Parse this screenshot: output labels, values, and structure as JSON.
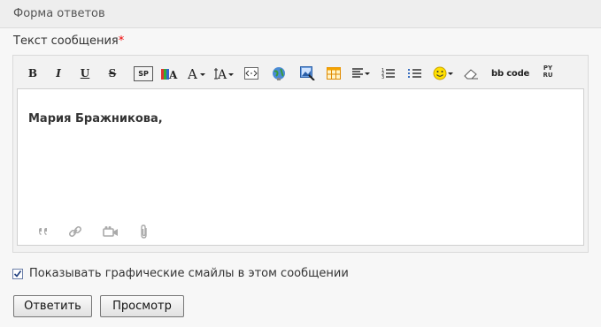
{
  "header": {
    "title": "Форма ответов"
  },
  "form": {
    "label": "Текст сообщения",
    "required_mark": "*"
  },
  "toolbar": {
    "bold": "B",
    "italic": "I",
    "underline": "U",
    "strike": "S",
    "spoiler": "SP",
    "bbcode": "bb code",
    "translit_top": "PY",
    "translit_bottom": "RU"
  },
  "editor": {
    "content": "Мария Бражникова,"
  },
  "options": {
    "show_smiles_label": "Показывать графические смайлы в этом сообщении",
    "show_smiles_checked": true
  },
  "actions": {
    "reply": "Ответить",
    "preview": "Просмотр"
  },
  "colors": {
    "header_bg": "#eeeeee",
    "required": "#e00000",
    "link_icon": "#2d6cc4"
  }
}
